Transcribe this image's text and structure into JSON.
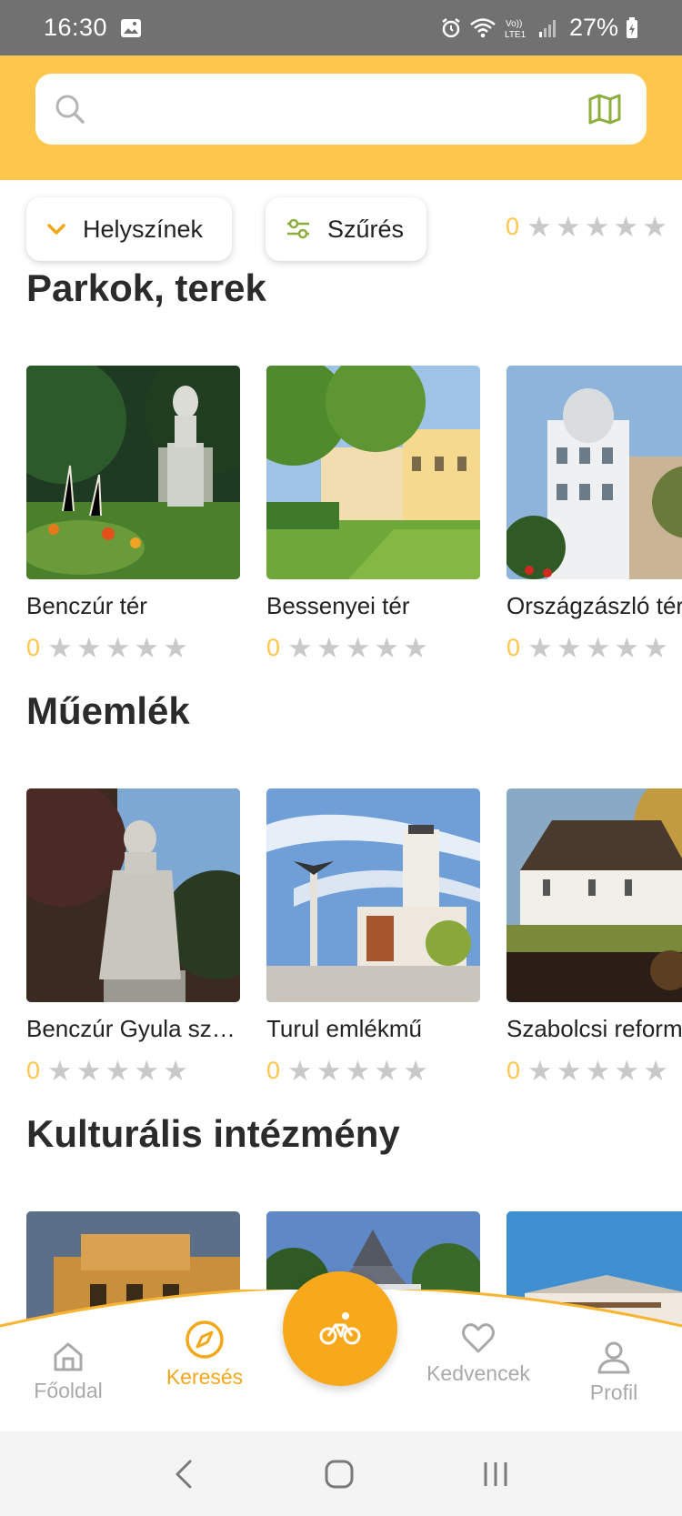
{
  "status_bar": {
    "time": "16:30",
    "battery": "27%",
    "network": "Vo) LTE1"
  },
  "search": {
    "placeholder": "",
    "value": ""
  },
  "filters": {
    "locations_label": "Helyszínek",
    "filter_label": "Szűrés"
  },
  "peek_rating": "0",
  "sections": [
    {
      "title": "Parkok, terek",
      "items": [
        {
          "name": "Benczúr tér",
          "rating": "0"
        },
        {
          "name": "Bessenyei tér",
          "rating": "0"
        },
        {
          "name": "Országzászló tér",
          "rating": "0"
        }
      ]
    },
    {
      "title": "Műemlék",
      "items": [
        {
          "name": "Benczúr Gyula sz…",
          "rating": "0"
        },
        {
          "name": "Turul emlékmű",
          "rating": "0"
        },
        {
          "name": "Szabolcsi reformátu",
          "rating": "0"
        }
      ]
    },
    {
      "title": "Kulturális intézmény",
      "items": []
    }
  ],
  "bottom_nav": {
    "home": "Főoldal",
    "search": "Keresés",
    "favorites": "Kedvencek",
    "profile": "Profil"
  },
  "colors": {
    "accent": "#FDC64C",
    "active": "#F3A71A",
    "inactive": "#A9A9A9"
  }
}
